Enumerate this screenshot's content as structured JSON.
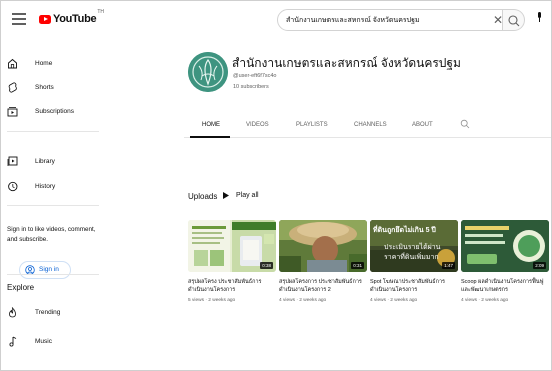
{
  "header": {
    "logo_text": "YouTube",
    "logo_country": "TH",
    "search_value": "สำนักงานเกษตรและสหกรณ์ จังหวัดนครปฐม"
  },
  "sidebar": {
    "items": [
      {
        "label": "Home",
        "icon": "home-icon"
      },
      {
        "label": "Shorts",
        "icon": "shorts-icon"
      },
      {
        "label": "Subscriptions",
        "icon": "subscriptions-icon"
      },
      {
        "label": "Library",
        "icon": "library-icon"
      },
      {
        "label": "History",
        "icon": "history-icon"
      }
    ],
    "signin_prompt": "Sign in to like videos, comment, and subscribe.",
    "signin_label": "Sign in",
    "explore_title": "Explore",
    "explore_items": [
      {
        "label": "Trending",
        "icon": "trending-icon"
      },
      {
        "label": "Music",
        "icon": "music-icon"
      }
    ]
  },
  "channel": {
    "name": "สำนักงานเกษตรและสหกรณ์ จังหวัดนครปฐม",
    "handle": "@user-eft6f7sc4o",
    "subscribers": "10 subscribers"
  },
  "tabs": [
    {
      "label": "HOME",
      "active": true
    },
    {
      "label": "VIDEOS",
      "active": false
    },
    {
      "label": "PLAYLISTS",
      "active": false
    },
    {
      "label": "CHANNELS",
      "active": false
    },
    {
      "label": "ABOUT",
      "active": false
    }
  ],
  "uploads": {
    "title": "Uploads",
    "play_all": "Play all"
  },
  "videos": [
    {
      "title": "สรุปผลโครง ประชาสัมพันธ์การดำเนินงานโครงการ",
      "meta": "5 views · 2 weeks ago",
      "duration": "0:38"
    },
    {
      "title": "สรุปผลโครงการ ประชาสัมพันธ์การดำเนินงานโครงการ 2",
      "meta": "4 views · 2 weeks ago",
      "duration": "0:31"
    },
    {
      "title": "Spot โฆษณาประชาสัมพันธ์การดำเนินงานโครงการ",
      "meta": "4 views · 2 weeks ago",
      "duration": "1:47",
      "thumb_text_1": "ที่ดินถูกยึดไม่เกิน 5 ปี",
      "thumb_text_2": "ประเมินรายได้ผ่าน",
      "thumb_text_3": "ราคาที่ดินเพิ่มมาก"
    },
    {
      "title": "Scoop ผลดำเนินงานโครงการฟื้นฟูและพัฒนาเกษตรกร",
      "meta": "4 views · 2 weeks ago",
      "duration": "2:09"
    }
  ]
}
